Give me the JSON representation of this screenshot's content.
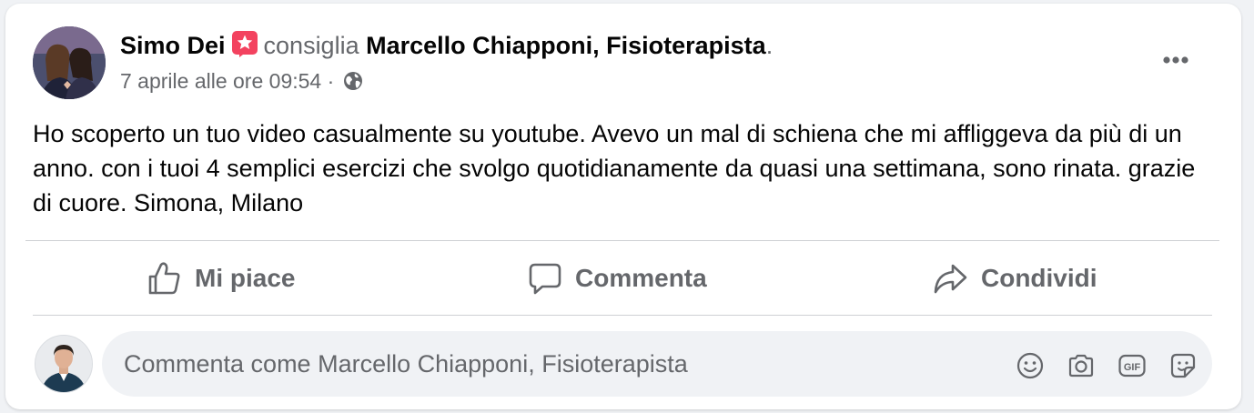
{
  "post": {
    "author": "Simo Dei",
    "verb": "consiglia",
    "page_name": "Marcello Chiapponi, Fisioterapista",
    "trailing_dot": ".",
    "timestamp": "7 aprile alle ore 09:54",
    "separator": "·",
    "audience_icon": "globe-icon",
    "recommend_icon": "star-badge-icon",
    "body": "Ho scoperto un tuo video casualmente su youtube. Avevo un mal di schiena che mi affliggeva da più di un anno. con i tuoi 4 semplici esercizi che svolgo quotidianamente da quasi una settimana, sono rinata. grazie di cuore. Simona, Milano"
  },
  "actions": {
    "like_label": "Mi piace",
    "comment_label": "Commenta",
    "share_label": "Condividi"
  },
  "comment_box": {
    "placeholder": "Commenta come Marcello Chiapponi, Fisioterapista",
    "icons": [
      "emoji-icon",
      "camera-icon",
      "gif-icon",
      "sticker-icon"
    ]
  },
  "colors": {
    "text_primary": "#050505",
    "text_secondary": "#65676b",
    "badge": "#f3425f",
    "divider": "#ced0d4",
    "input_bg": "#f0f2f5"
  }
}
